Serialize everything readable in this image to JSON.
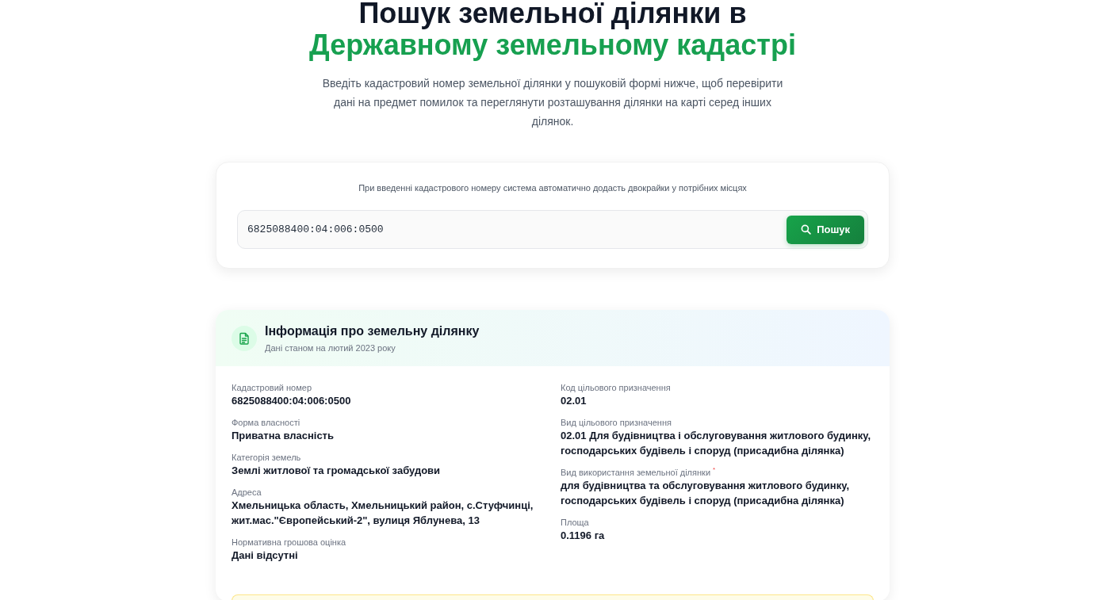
{
  "page_title": {
    "line_1": "Пошук земельної ділянки в",
    "line_2": "Державному земельному кадастрі"
  },
  "intro": "Введіть кадастровий номер земельної ділянки у пошуковій формі нижче, щоб перевірити дані на предмет помилок та переглянути розташування ділянки на карті серед інших ділянок.",
  "search": {
    "hint": "При введенні кадастрового номеру система автоматично додасть двокрайки у потрібних місцях",
    "value": "6825088400:04:006:0500",
    "button": "Пошук"
  },
  "parcel_info": {
    "title": "Інформація про земельну ділянку",
    "subtitle": "Дані станом на лютий 2023 року",
    "columns": [
      {
        "fields": [
          {
            "label": "Кадастровий номер",
            "value": "6825088400:04:006:0500"
          },
          {
            "label": "Форма власності",
            "value": "Приватна власність"
          },
          {
            "label": "Категорія земель",
            "value": "Землі житлової та громадської забудови"
          },
          {
            "label": "Адреса",
            "value": "Хмельницька область, Хмельницький район, с.Стуфчинці, жит.мас.\"Європейський-2\", вулиця Яблунева, 13"
          },
          {
            "label": "Нормативна грошова оцінка",
            "value": "Дані відсутні"
          }
        ]
      },
      {
        "fields": [
          {
            "label": "Код цільового призначення",
            "value": "02.01"
          },
          {
            "label": "Вид цільового призначення",
            "value": "02.01 Для будівництва і обслуговування житлового будинку, господарських будівель і споруд (присадибна ділянка)"
          },
          {
            "label": "Вид використання земельної ділянки $^{*}$",
            "value": "для будівництва та обслуговування житлового будинку, господарських будівель і споруд (присадибна ділянка)"
          },
          {
            "label": "Площа",
            "value": "0.1196 га"
          }
        ]
      }
    ]
  },
  "notice": {
    "kind": "warning"
  }
}
